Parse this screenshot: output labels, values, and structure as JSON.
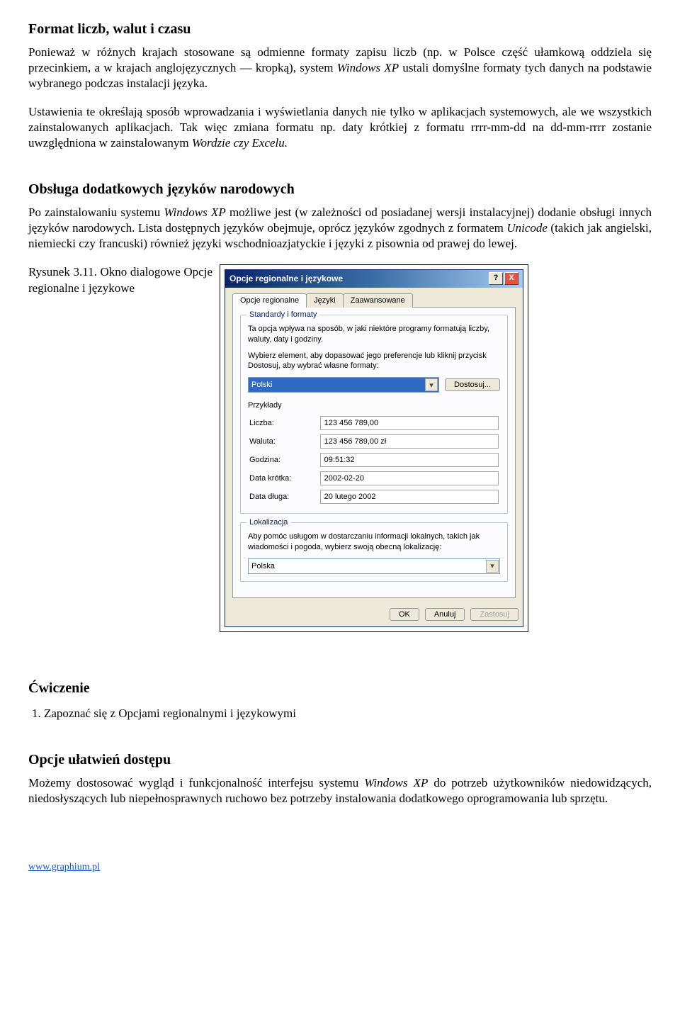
{
  "section1": {
    "title": "Format liczb, walut i czasu",
    "p1_a": "Ponieważ w różnych krajach stosowane są odmienne formaty zapisu liczb (np. w Polsce część ułamkową oddziela się przecinkiem, a w krajach anglojęzycznych — kropką), system ",
    "p1_i": "Windows XP",
    "p1_b": " ustali domyślne formaty tych danych na podstawie wybranego podczas instalacji języka.",
    "p2_a": "Ustawienia te określają sposób wprowadzania i wyświetlania danych nie tylko w aplikacjach systemowych, ale we wszystkich zainstalowanych aplikacjach. Tak więc zmiana formatu np. daty krótkiej z formatu rrrr-mm-dd na dd-mm-rrrr zostanie uwzględniona w zainstalowanym ",
    "p2_i": "Wordzie czy Excelu.",
    "p2_b": ""
  },
  "section2": {
    "title": "Obsługa dodatkowych języków narodowych",
    "p1_a": "Po zainstalowaniu systemu ",
    "p1_i1": "Windows XP",
    "p1_b": " możliwe jest (w zależności od posiadanej wersji instalacyjnej) dodanie obsługi innych języków narodowych. Lista dostępnych języków obejmuje, oprócz języków zgodnych z formatem ",
    "p1_i2": "Unicode",
    "p1_c": " (takich jak angielski, niemiecki czy francuski) również języki wschodnioazjatyckie i języki z pisownia od prawej do lewej.",
    "caption": "Rysunek 3.11. Okno dialogowe Opcje regionalne i językowe"
  },
  "dialog": {
    "title": "Opcje regionalne i językowe",
    "help": "?",
    "close": "X",
    "tabs": {
      "t1": "Opcje regionalne",
      "t2": "Języki",
      "t3": "Zaawansowane"
    },
    "group_formats": {
      "legend": "Standardy i formaty",
      "desc1": "Ta opcja wpływa na sposób, w jaki niektóre programy formatują liczby, waluty, daty i godziny.",
      "desc2": "Wybierz element, aby dopasować jego preferencje lub kliknij przycisk Dostosuj, aby wybrać własne formaty:",
      "language": "Polski",
      "customize": "Dostosuj...",
      "examples_label": "Przykłady",
      "rows": {
        "number_l": "Liczba:",
        "number_v": "123 456 789,00",
        "currency_l": "Waluta:",
        "currency_v": "123 456 789,00 zł",
        "time_l": "Godzina:",
        "time_v": "09:51:32",
        "sdate_l": "Data krótka:",
        "sdate_v": "2002-02-20",
        "ldate_l": "Data długa:",
        "ldate_v": "20 lutego 2002"
      }
    },
    "group_loc": {
      "legend": "Lokalizacja",
      "desc": "Aby pomóc usługom w dostarczaniu informacji lokalnych, takich jak wiadomości i pogoda, wybierz swoją obecną lokalizację:",
      "value": "Polska"
    },
    "buttons": {
      "ok": "OK",
      "cancel": "Anuluj",
      "apply": "Zastosuj"
    }
  },
  "exercise": {
    "title": "Ćwiczenie",
    "item1": "Zapoznać się z Opcjami regionalnymi i językowymi"
  },
  "section3": {
    "title": "Opcje ułatwień dostępu",
    "p_a": "Możemy dostosować wygląd i funkcjonalność interfejsu systemu ",
    "p_i": "Windows XP",
    "p_b": " do potrzeb użytkowników niedowidzących, niedosłyszących lub niepełnosprawnych ruchowo bez potrzeby instalowania dodatkowego oprogramowania lub sprzętu."
  },
  "footer": {
    "url": "www.graphium.pl"
  }
}
